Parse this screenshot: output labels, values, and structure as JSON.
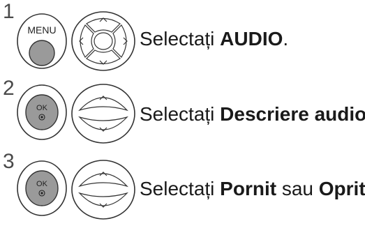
{
  "steps": [
    {
      "number": "1",
      "button_label": "MENU",
      "text_prefix": "Selectați ",
      "text_bold": "AUDIO",
      "text_suffix": "."
    },
    {
      "number": "2",
      "button_label": "OK",
      "text_prefix": "Selectați ",
      "text_bold": "Descriere audio",
      "text_suffix": "."
    },
    {
      "number": "3",
      "button_label": "OK",
      "text_prefix": "Selectați ",
      "text_bold": "Pornit",
      "text_middle": " sau ",
      "text_bold2": "Oprit",
      "text_suffix": "."
    }
  ],
  "icons": {
    "menu_button": "menu-button-icon",
    "nav_pad": "navigation-pad-icon",
    "ok_button": "ok-button-icon",
    "updown_pad": "up-down-pad-icon"
  },
  "colors": {
    "button_fill": "#999999",
    "button_outline": "#333333",
    "pad_outline": "#333333",
    "text": "#1a1a1a"
  }
}
